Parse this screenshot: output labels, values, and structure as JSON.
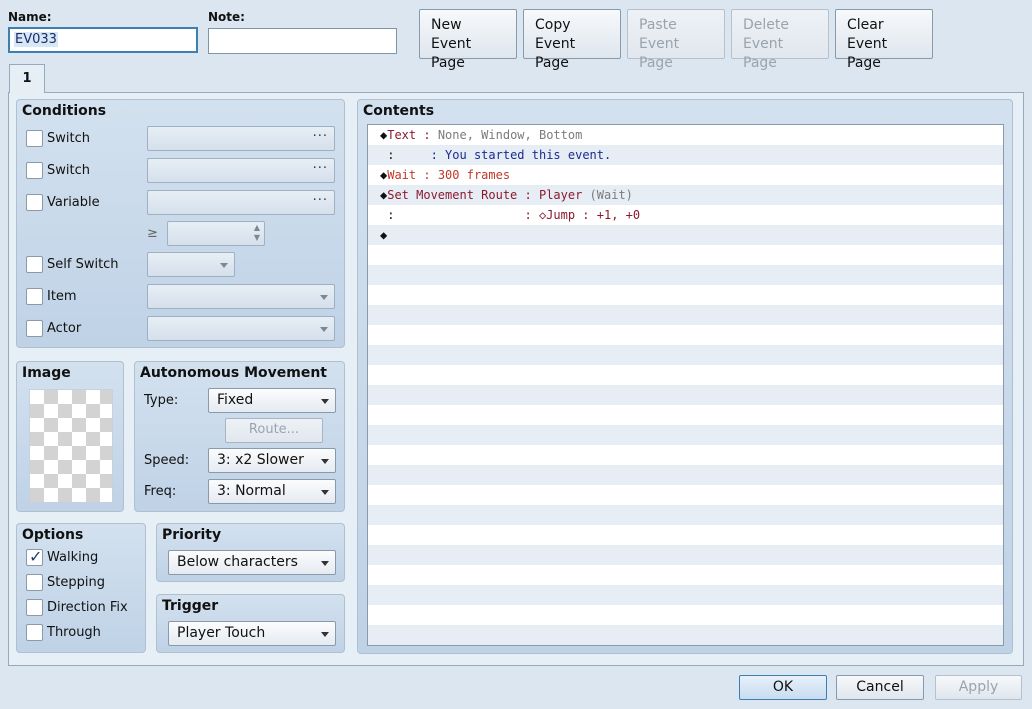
{
  "header": {
    "name_label": "Name:",
    "name_value": "EV033",
    "note_label": "Note:",
    "note_value": ""
  },
  "toolbar": {
    "new_l1": "New",
    "new_l2": "Event Page",
    "copy_l1": "Copy",
    "copy_l2": "Event Page",
    "paste_l1": "Paste",
    "paste_l2": "Event Page",
    "delete_l1": "Delete",
    "delete_l2": "Event Page",
    "clear_l1": "Clear",
    "clear_l2": "Event Page"
  },
  "tabs": [
    "1"
  ],
  "conditions": {
    "title": "Conditions",
    "switch1": "Switch",
    "switch2": "Switch",
    "variable": "Variable",
    "ge": "≥",
    "self_switch": "Self Switch",
    "item": "Item",
    "actor": "Actor",
    "ellipsis": "···"
  },
  "image": {
    "title": "Image"
  },
  "movement": {
    "title": "Autonomous Movement",
    "type_label": "Type:",
    "type_value": "Fixed",
    "route_button": "Route...",
    "speed_label": "Speed:",
    "speed_value": "3: x2 Slower",
    "freq_label": "Freq:",
    "freq_value": "3: Normal"
  },
  "options": {
    "title": "Options",
    "walking": "Walking",
    "walking_checked": true,
    "stepping": "Stepping",
    "direction_fix": "Direction Fix",
    "through": "Through"
  },
  "priority": {
    "title": "Priority",
    "value": "Below characters"
  },
  "trigger": {
    "title": "Trigger",
    "value": "Player Touch"
  },
  "contents": {
    "title": "Contents",
    "lines": [
      {
        "diamond": "◆",
        "cmd": "Text",
        "sep": " : ",
        "arg": "None, Window, Bottom",
        "arg2": ""
      },
      {
        "diamond": "",
        "cmd": " :    ",
        "sep": " : ",
        "arg": "You started this event.",
        "arg2": ""
      },
      {
        "diamond": "◆",
        "cmd": "Wait",
        "sep": " : ",
        "arg": "300 frames",
        "arg2": ""
      },
      {
        "diamond": "◆",
        "cmd": "Set Movement Route",
        "sep": " : ",
        "arg": "Player",
        "arg2": " (Wait)"
      },
      {
        "diamond": "",
        "cmd": " :                ",
        "sep": "  : ",
        "arg": "◇Jump : +1, +0",
        "arg2": ""
      },
      {
        "diamond": "◆",
        "cmd": "",
        "sep": "",
        "arg": "",
        "arg2": ""
      }
    ]
  },
  "footer": {
    "ok": "OK",
    "cancel": "Cancel",
    "apply": "Apply"
  },
  "colors": {
    "command": "#8b1a2e",
    "text_arg": "#1b2b8f",
    "gray": "#7c7c7c",
    "selection": "#3c7fb1"
  },
  "icons": {
    "checkbox_check": "check-icon",
    "dropdown": "chevron-down-icon",
    "spinner": "spinner-icon",
    "diamond": "diamond-icon"
  }
}
